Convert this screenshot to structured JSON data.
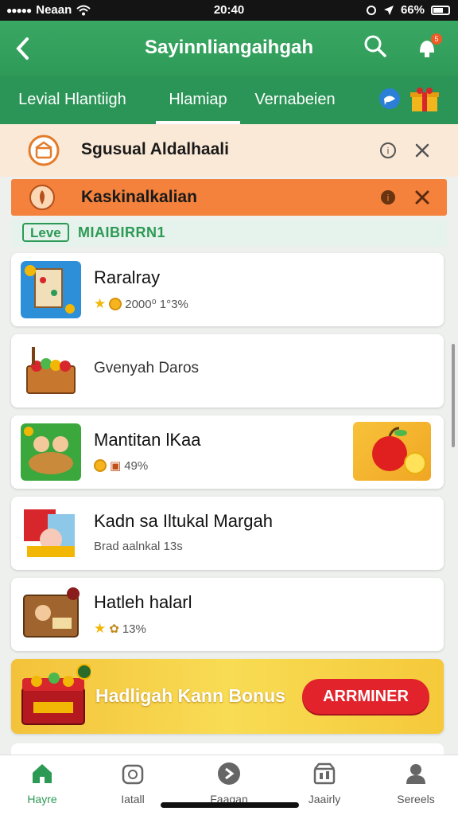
{
  "status_bar": {
    "carrier": "Neaan",
    "time": "20:40",
    "battery": "66%"
  },
  "header": {
    "title": "Sayinnliangaihgah",
    "notification_count": "5"
  },
  "tabs": [
    {
      "label": "Levial Hlantiigh"
    },
    {
      "label": "Hlamiap"
    },
    {
      "label": "Vernabeien"
    }
  ],
  "banners": [
    {
      "text": "Sgusual Aldalhaali"
    },
    {
      "text": "Kaskinalkalian"
    }
  ],
  "level": {
    "badge": "Leve",
    "title": "MIAIBIRRN1"
  },
  "items": [
    {
      "name": "Raralray",
      "meta": "2000⁰ 1°3%"
    },
    {
      "name": "Gvenyah Daros",
      "meta": ""
    },
    {
      "name": "Mantitan lKaa",
      "meta": "49%"
    },
    {
      "name": "Kadn sa Iltukal Margah",
      "meta": "Brad aalnkal 13s"
    },
    {
      "name": "Hatleh halarl",
      "meta": "13%"
    }
  ],
  "bonus": {
    "text": "Hadligah Kann Bonus",
    "button": "ARRMINER"
  },
  "nav": [
    {
      "label": "Hayre"
    },
    {
      "label": "Iatall"
    },
    {
      "label": "Faagan"
    },
    {
      "label": "Jaairly"
    },
    {
      "label": "Sereels"
    }
  ],
  "colors": {
    "brand_green": "#2f9a58",
    "banner_orange": "#f4823c",
    "bonus_red": "#e2232b",
    "bonus_gold": "#f3c23a"
  }
}
